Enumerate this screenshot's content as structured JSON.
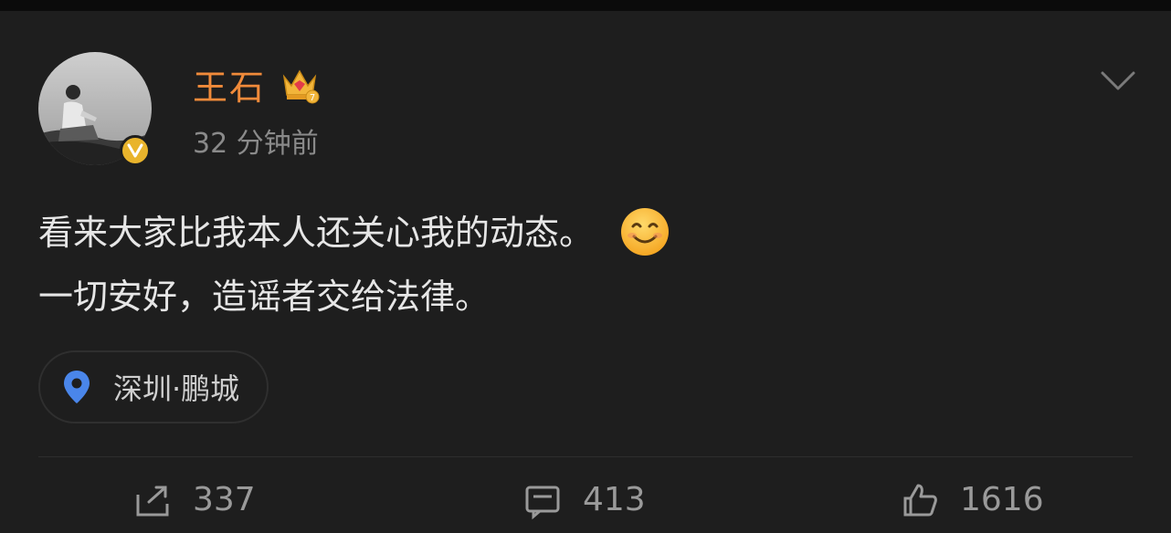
{
  "user": {
    "name": "王石",
    "timestamp": "32 分钟前",
    "verified": true,
    "badge_icon": "crown-badge-icon"
  },
  "post": {
    "lines": [
      "看来大家比我本人还关心我的动态。",
      "一切安好，造谣者交给法律。"
    ],
    "emoji": "smiling-face-emoji"
  },
  "location": {
    "text": "深圳·鹏城",
    "icon": "location-pin-icon"
  },
  "actions": {
    "repost_count": "337",
    "comment_count": "413",
    "like_count": "1616"
  },
  "colors": {
    "background": "#1e1e1e",
    "username": "#f08a3a",
    "text": "#e6e6e6",
    "muted": "#8a8a8a",
    "pin": "#4a86ea",
    "verified": "#e9b42c"
  }
}
